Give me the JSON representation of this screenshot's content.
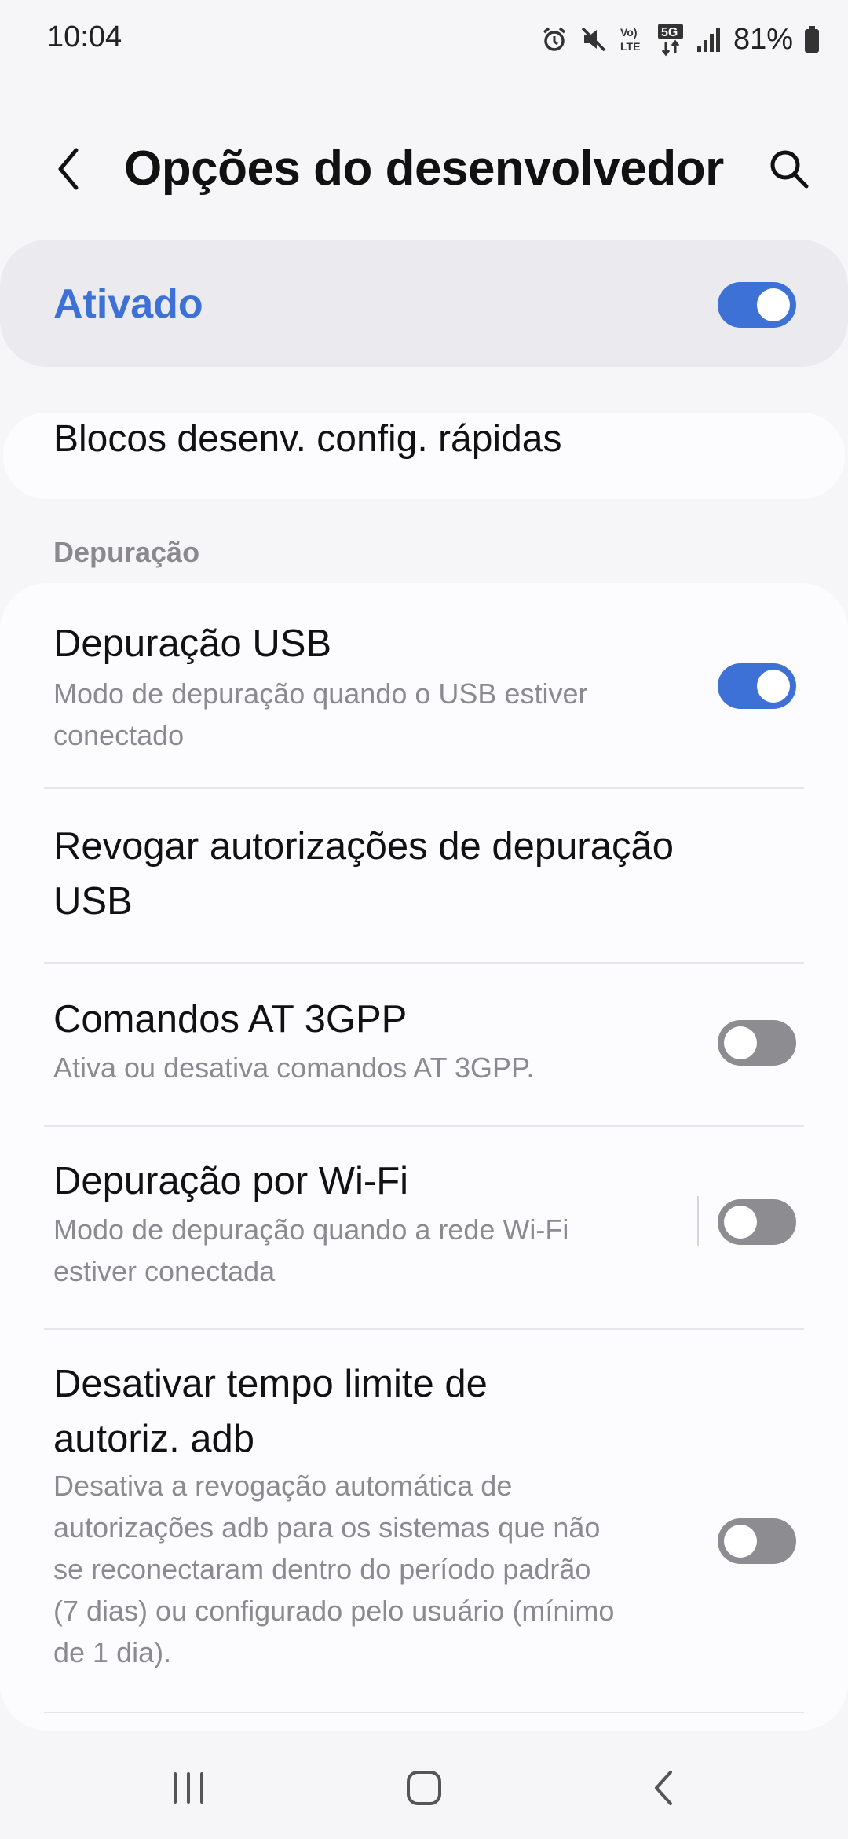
{
  "status_bar": {
    "time": "10:04",
    "battery_percent": "81%",
    "icons": [
      "alarm-icon",
      "mute-icon",
      "volte-icon",
      "5g-icon",
      "signal-icon",
      "battery-icon"
    ]
  },
  "header": {
    "title": "Opções do desenvolvedor",
    "back_icon": "chevron-left-icon",
    "search_icon": "search-icon"
  },
  "master_switch": {
    "label": "Ativado",
    "on": true
  },
  "quick_tiles": {
    "label": "Blocos desenv. config. rápidas"
  },
  "section": {
    "title": "Depuração"
  },
  "settings": [
    {
      "title_lines": [
        "Depuração USB"
      ],
      "subtitle_lines": [
        "Modo de depuração quando o USB estiver",
        "conectado"
      ],
      "toggle": true,
      "on": true
    },
    {
      "title_lines": [
        "Revogar autorizações de depuração",
        "USB"
      ],
      "subtitle_lines": [],
      "toggle": false
    },
    {
      "title_lines": [
        "Comandos AT 3GPP"
      ],
      "subtitle_lines": [
        "Ativa ou desativa comandos AT 3GPP."
      ],
      "toggle": true,
      "on": false
    },
    {
      "title_lines": [
        "Depuração por Wi-Fi"
      ],
      "subtitle_lines": [
        "Modo de depuração quando a rede Wi-Fi",
        "estiver conectada"
      ],
      "toggle": true,
      "on": false
    },
    {
      "title_lines": [
        "Desativar tempo limite de",
        "autoriz. adb"
      ],
      "subtitle_lines": [
        "Desativa a revogação automática de",
        "autorizações adb para os sistemas que não",
        "se reconectaram dentro do período padrão",
        "(7 dias) ou configurado pelo usuário (mínimo",
        "de 1 dia)."
      ],
      "toggle": true,
      "on": false
    }
  ],
  "nav_bar": {
    "recents_icon": "recents-icon",
    "home_icon": "home-icon",
    "back_icon": "back-icon"
  },
  "colors": {
    "accent": "#3e71d6",
    "toggle_off": "#8d8d91",
    "background": "#f6f6f8",
    "card": "#fcfcfe",
    "subtitle": "#8b8b8f"
  }
}
